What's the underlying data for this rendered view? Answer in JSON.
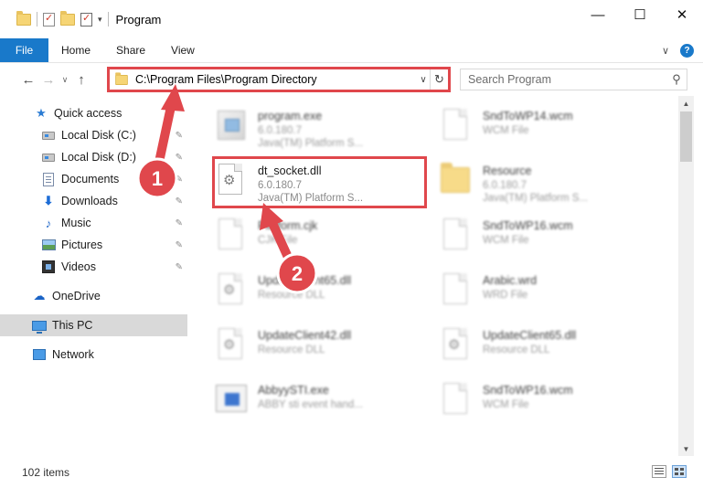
{
  "window": {
    "title": "Program",
    "controls": {
      "minimize": "—",
      "maximize": "☐",
      "close": "✕"
    }
  },
  "quick_access_toolbar": {
    "dropdown_glyph": "▾"
  },
  "ribbon": {
    "tabs": [
      {
        "label": "File"
      },
      {
        "label": "Home"
      },
      {
        "label": "Share"
      },
      {
        "label": "View"
      }
    ],
    "collapse_glyph": "∨",
    "help_glyph": "?"
  },
  "navigation": {
    "back_glyph": "←",
    "forward_glyph": "→",
    "recent_glyph": "∨",
    "up_glyph": "↑",
    "address": "C:\\Program Files\\Program Directory",
    "address_dropdown_glyph": "∨",
    "refresh_glyph": "↻",
    "search_placeholder": "Search Program",
    "search_glyph": "⚲"
  },
  "sidebar": {
    "items": [
      {
        "label": "Quick access",
        "icon": "star-icon",
        "pinned": false
      },
      {
        "label": "Local Disk (C:)",
        "icon": "disk-icon",
        "pinned": true
      },
      {
        "label": "Local Disk (D:)",
        "icon": "disk-icon",
        "pinned": true
      },
      {
        "label": "Documents",
        "icon": "documents-icon",
        "pinned": true
      },
      {
        "label": "Downloads",
        "icon": "downloads-icon",
        "pinned": true
      },
      {
        "label": "Music",
        "icon": "music-icon",
        "pinned": true
      },
      {
        "label": "Pictures",
        "icon": "pictures-icon",
        "pinned": true
      },
      {
        "label": "Videos",
        "icon": "videos-icon",
        "pinned": true
      },
      {
        "label": "OneDrive",
        "icon": "onedrive-icon",
        "pinned": false
      },
      {
        "label": "This PC",
        "icon": "this-pc-icon",
        "pinned": false,
        "selected": true
      },
      {
        "label": "Network",
        "icon": "network-icon",
        "pinned": false
      }
    ],
    "pin_glyph": "📌"
  },
  "files": [
    {
      "name": "program.exe",
      "line2": "6.0.180.7",
      "line3": "Java(TM) Platform S...",
      "icon": "exe-icon"
    },
    {
      "name": "SndToWP14.wcm",
      "line2": "WCM File",
      "line3": "",
      "icon": "blank-file-icon"
    },
    {
      "name": "dt_socket.dll",
      "line2": "6.0.180.7",
      "line3": "Java(TM) Platform S...",
      "icon": "dll-gear-icon",
      "highlighted": true
    },
    {
      "name": "Resource",
      "line2": "6.0.180.7",
      "line3": "Java(TM) Platform S...",
      "icon": "folder-icon"
    },
    {
      "name": "Platform.cjk",
      "line2": "CJK File",
      "line3": "",
      "icon": "blank-file-icon"
    },
    {
      "name": "SndToWP16.wcm",
      "line2": "WCM File",
      "line3": "",
      "icon": "blank-file-icon"
    },
    {
      "name": "UpdateClient65.dll",
      "line2": "Resource DLL",
      "line3": "",
      "icon": "dll-gear-icon"
    },
    {
      "name": "Arabic.wrd",
      "line2": "WRD File",
      "line3": "",
      "icon": "blank-file-icon"
    },
    {
      "name": "UpdateClient42.dll",
      "line2": "Resource DLL",
      "line3": "",
      "icon": "dll-gear-icon"
    },
    {
      "name": "UpdateClient65.dll",
      "line2": "Resource DLL",
      "line3": "",
      "icon": "dll-gear-icon"
    },
    {
      "name": "AbbyySTI.exe",
      "line2": "ABBY sti event hand...",
      "line3": "",
      "icon": "app-icon"
    },
    {
      "name": "SndToWP16.wcm",
      "line2": "WCM File",
      "line3": "",
      "icon": "blank-file-icon"
    }
  ],
  "status": {
    "item_count": "102 items"
  },
  "annotations": {
    "step1": "1",
    "step2": "2",
    "accent_color": "#e0474c"
  },
  "colors": {
    "file_tab": "#1979ca",
    "selected_nav": "#d9d9d9"
  }
}
